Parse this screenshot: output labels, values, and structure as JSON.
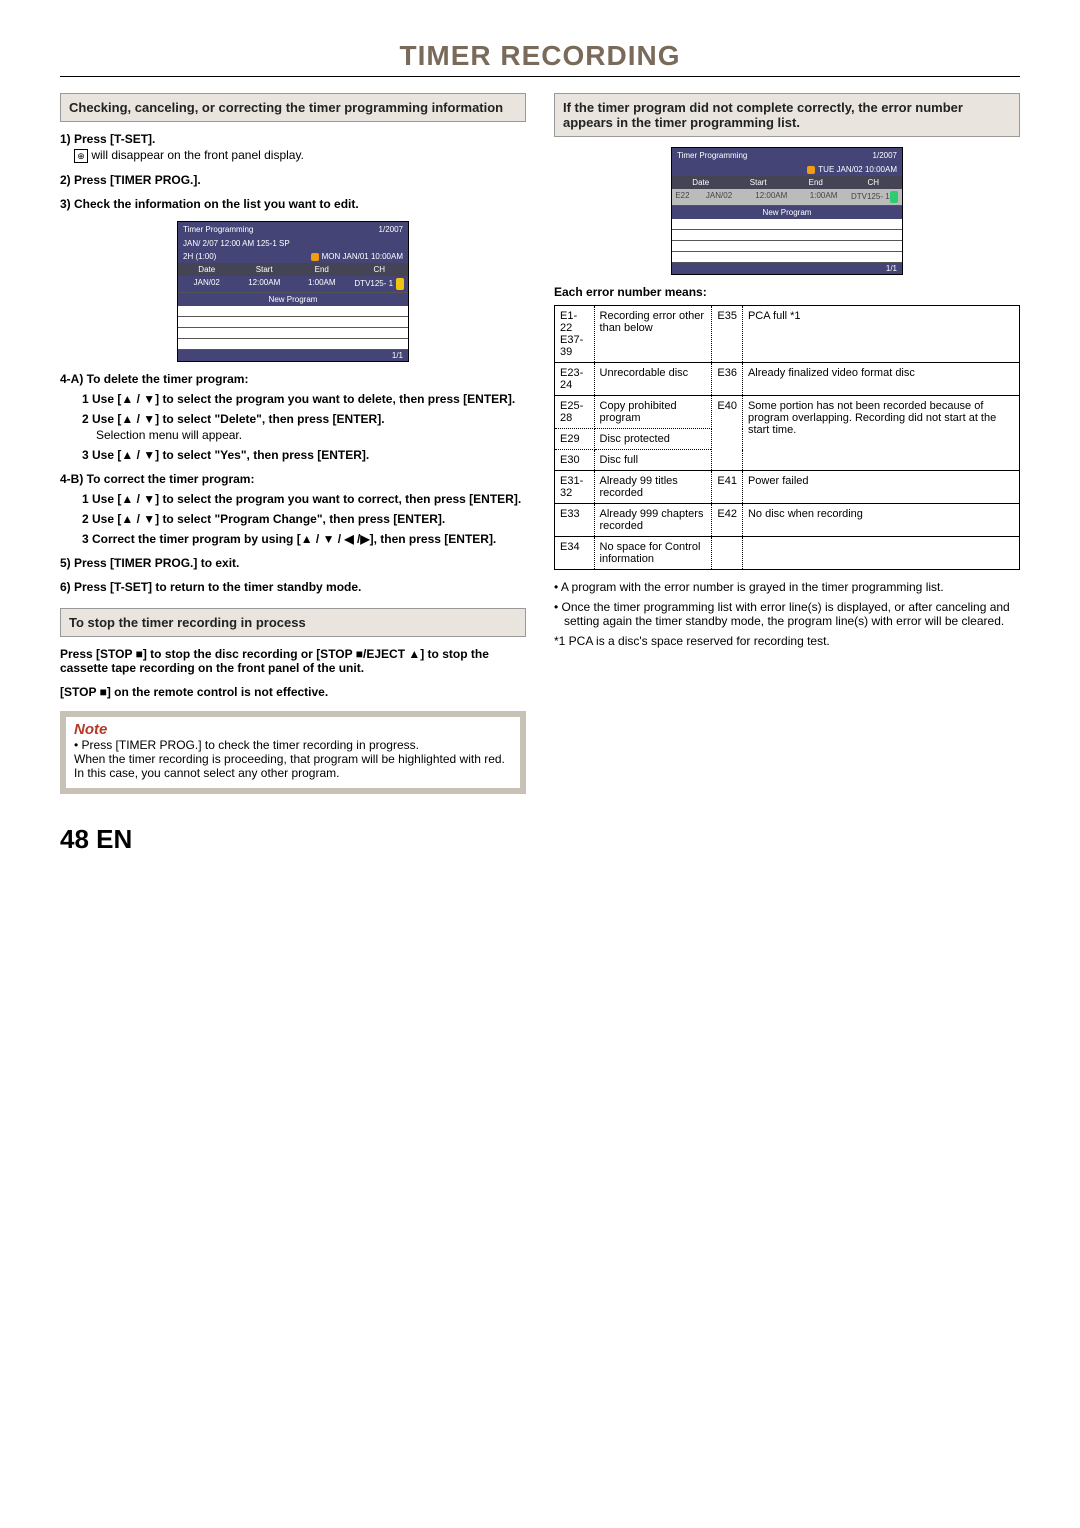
{
  "title": "TIMER RECORDING",
  "left": {
    "heading": "Checking, canceling, or correcting the timer programming information",
    "s1": "1) Press [T-SET].",
    "s1_body": "will disappear on the front panel display.",
    "clock_icon": "⊕",
    "s2": "2) Press [TIMER PROG.].",
    "s3": "3) Check the information on the list you want to edit.",
    "screen": {
      "title": "Timer Programming",
      "badge": "1/2007",
      "line1": "JAN/ 2/07 12:00 AM 125-1 SP",
      "line2a": "2H  (1:00)",
      "line2b": "MON JAN/01 10:00AM",
      "headers": [
        "Date",
        "Start",
        "End",
        "CH"
      ],
      "row": [
        "JAN/02",
        "12:00AM",
        "1:00AM",
        "DTV125- 1"
      ],
      "newprog": "New Program",
      "pager": "1/1"
    },
    "s4a": "4-A) To delete the timer program:",
    "s4a1": "1 Use [▲ / ▼] to select the program you want to delete, then press [ENTER].",
    "s4a2": "2 Use [▲ / ▼] to select \"Delete\", then press [ENTER].",
    "s4a2b": "Selection menu will appear.",
    "s4a3": "3 Use [▲ / ▼] to select \"Yes\", then press [ENTER].",
    "s4b": "4-B) To correct the timer program:",
    "s4b1": "1 Use [▲ / ▼] to select the program you want to correct, then press [ENTER].",
    "s4b2": "2 Use [▲ / ▼] to select \"Program Change\", then press [ENTER].",
    "s4b3": "3 Correct the timer program by using [▲ / ▼ / ◀ /▶], then press [ENTER].",
    "s5": "5) Press [TIMER PROG.] to exit.",
    "s6": "6) Press [T-SET] to return to the timer standby mode.",
    "stop_heading": "To stop the timer recording in process",
    "stop_body1": "Press [STOP ■] to stop the disc recording or [STOP ■/EJECT ▲] to stop the cassette tape recording on the front panel of the unit.",
    "stop_body2": "[STOP ■] on the remote control is not effective.",
    "note_head": "Note",
    "note_body": "• Press [TIMER PROG.] to check the timer recording in progress.\nWhen the timer recording is proceeding, that program will be highlighted with red. In this case, you cannot select any other program."
  },
  "right": {
    "heading": "If the timer program did not complete correctly, the error number appears in the timer programming list.",
    "screen": {
      "title": "Timer Programming",
      "badge": "1/2007",
      "line2b": "TUE JAN/02 10:00AM",
      "headers": [
        "Date",
        "Start",
        "End",
        "CH"
      ],
      "row": [
        "JAN/02",
        "12:00AM",
        "1:00AM",
        "DTV125- 1"
      ],
      "rowcode": "E22",
      "newprog": "New Program",
      "pager": "1/1"
    },
    "err_label": "Each error number means:",
    "errs": [
      [
        "E1-22\nE37-39",
        "Recording error other than below",
        "E35",
        "PCA full *1"
      ],
      [
        "E23-24",
        "Unrecordable disc",
        "E36",
        "Already finalized video format disc"
      ],
      [
        "E25-28",
        "Copy prohibited program",
        "E40",
        "Some portion has not been recorded because of program overlapping. Recording did not start at the start time."
      ],
      [
        "E29",
        "Disc protected",
        "",
        ""
      ],
      [
        "E30",
        "Disc full",
        "",
        ""
      ],
      [
        "E31-32",
        "Already 99 titles recorded",
        "E41",
        "Power failed"
      ],
      [
        "E33",
        "Already 999 chapters recorded",
        "E42",
        "No disc when recording"
      ],
      [
        "E34",
        "No space for Control information",
        "",
        ""
      ]
    ],
    "b1": "• A program with the error number is grayed in the timer programming list.",
    "b2": "• Once the timer programming list with error line(s) is displayed, or after canceling and setting again the timer standby mode, the program line(s) with error will be cleared.",
    "b3": "*1 PCA is a disc's space reserved for recording test."
  },
  "page_num": "48",
  "page_lang": "EN"
}
